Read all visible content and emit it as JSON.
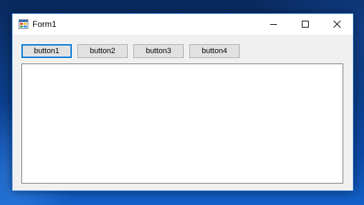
{
  "window": {
    "title": "Form1",
    "icon": "windows-form-icon",
    "caption_buttons": [
      "minimize-icon",
      "maximize-icon",
      "close-icon"
    ]
  },
  "toolbar": {
    "buttons": [
      {
        "label": "button1",
        "focused": true
      },
      {
        "label": "button2",
        "focused": false
      },
      {
        "label": "button3",
        "focused": false
      },
      {
        "label": "button4",
        "focused": false
      }
    ]
  },
  "textarea": {
    "value": ""
  },
  "colors": {
    "focus_border": "#0078d7",
    "button_face": "#e1e1e1",
    "window_border": "#1c6fc9"
  }
}
